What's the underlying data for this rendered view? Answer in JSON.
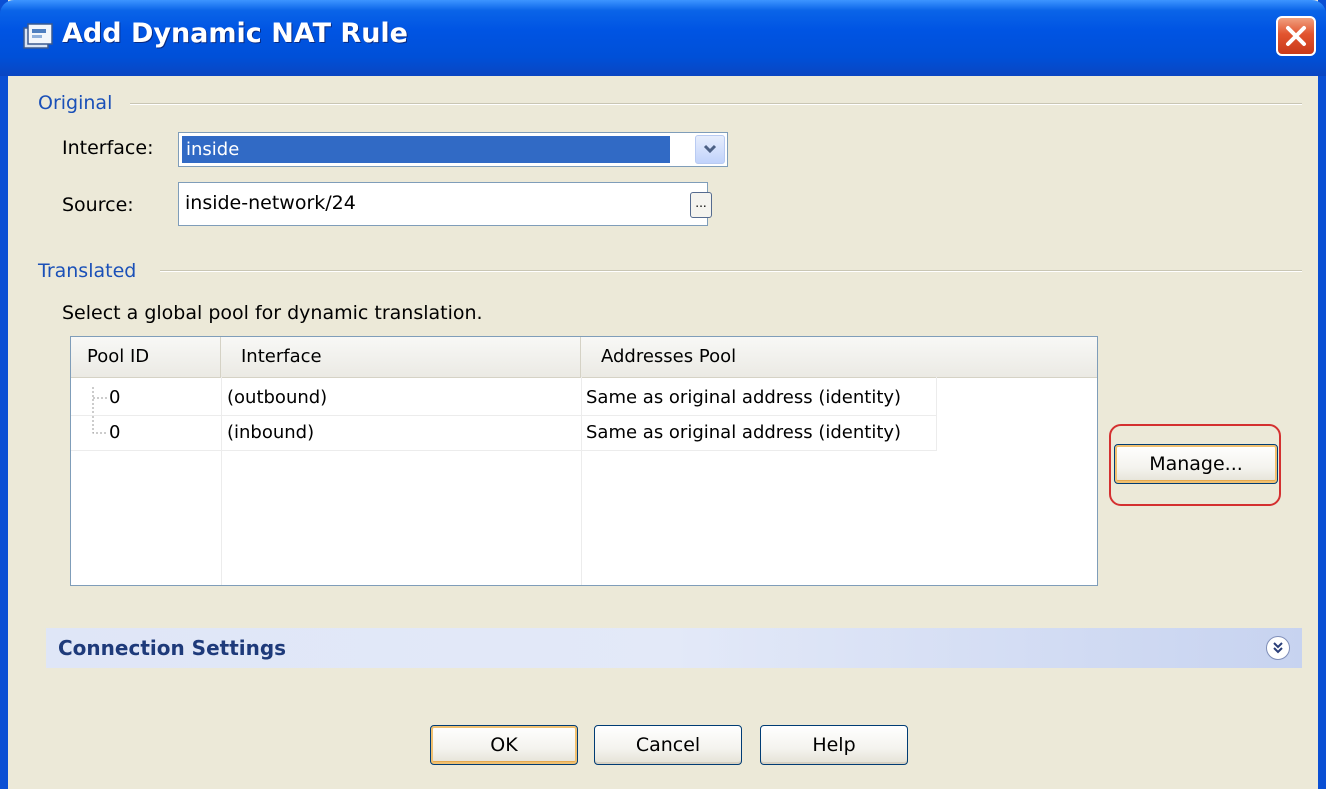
{
  "window": {
    "title": "Add Dynamic NAT Rule"
  },
  "original": {
    "group_label": "Original",
    "interface_label": "Interface:",
    "interface_value": "inside",
    "source_label": "Source:",
    "source_value": "inside-network/24",
    "browse_label": "..."
  },
  "translated": {
    "group_label": "Translated",
    "hint": "Select a global pool for dynamic translation.",
    "columns": [
      "Pool ID",
      "Interface",
      "Addresses Pool"
    ],
    "rows": [
      {
        "pool_id": "0",
        "interface": "(outbound)",
        "addresses_pool": "Same as original address (identity)"
      },
      {
        "pool_id": "0",
        "interface": "(inbound)",
        "addresses_pool": "Same as original address (identity)"
      }
    ],
    "manage_label": "Manage..."
  },
  "connection_settings": {
    "title": "Connection Settings"
  },
  "buttons": {
    "ok": "OK",
    "cancel": "Cancel",
    "help": "Help"
  },
  "colors": {
    "title_bar": "#0054e3",
    "selection": "#316ac5",
    "highlight_ring": "#d43030",
    "group_label": "#1a50b8"
  }
}
